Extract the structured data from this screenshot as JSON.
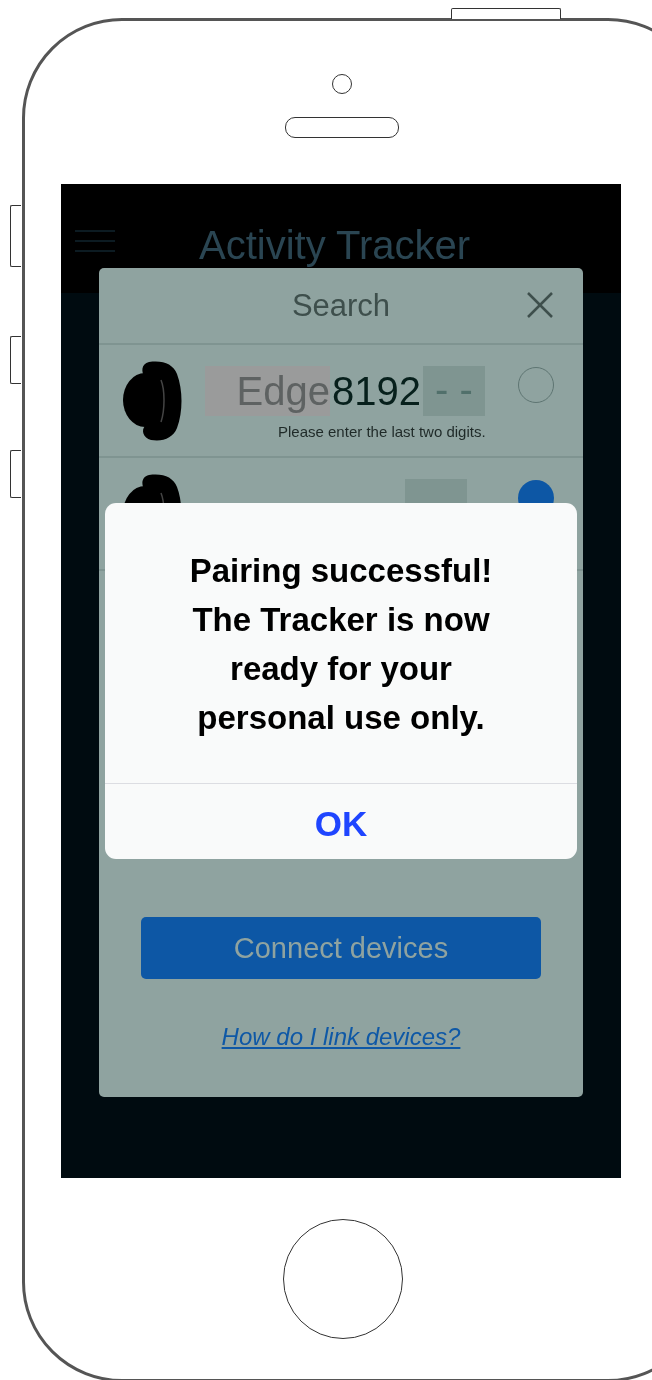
{
  "app_bar": {
    "title": "Activity Tracker"
  },
  "search_dialog": {
    "title": "Search",
    "devices": [
      {
        "name": "Edge",
        "number": "8192",
        "suffix": "- -",
        "hint": "Please enter the last two digits.",
        "selected": false
      },
      {
        "selected": true
      }
    ],
    "connect_button": "Connect devices",
    "help_link": "How do I link devices?"
  },
  "alert": {
    "message": "Pairing successful! The Tracker is now ready for your personal use only.",
    "button": "OK"
  }
}
